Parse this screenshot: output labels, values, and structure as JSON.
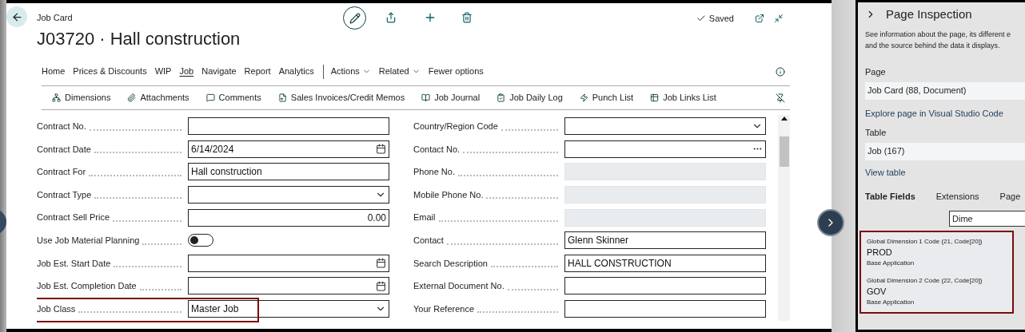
{
  "header": {
    "breadcrumb": "Job Card",
    "title": "J03720 · Hall construction",
    "status": "Saved"
  },
  "menu": [
    {
      "label": "Home",
      "selected": false,
      "dropdown": false
    },
    {
      "label": "Prices & Discounts",
      "selected": false,
      "dropdown": false
    },
    {
      "label": "WIP",
      "selected": false,
      "dropdown": false
    },
    {
      "label": "Job",
      "selected": true,
      "dropdown": false
    },
    {
      "label": "Navigate",
      "selected": false,
      "dropdown": false
    },
    {
      "label": "Report",
      "selected": false,
      "dropdown": false
    },
    {
      "label": "Analytics",
      "selected": false,
      "dropdown": false
    },
    {
      "label": "Actions",
      "selected": false,
      "dropdown": true
    },
    {
      "label": "Related",
      "selected": false,
      "dropdown": true
    },
    {
      "label": "Fewer options",
      "selected": false,
      "dropdown": false
    }
  ],
  "actions": [
    {
      "label": "Dimensions"
    },
    {
      "label": "Attachments"
    },
    {
      "label": "Comments"
    },
    {
      "label": "Sales Invoices/Credit Memos"
    },
    {
      "label": "Job Journal"
    },
    {
      "label": "Job Daily Log"
    },
    {
      "label": "Punch List"
    },
    {
      "label": "Job Links List"
    }
  ],
  "left_fields": [
    {
      "label": "Contract No.",
      "kind": "text"
    },
    {
      "label": "Contract Date",
      "kind": "date",
      "value": "6/14/2024"
    },
    {
      "label": "Contract For",
      "kind": "text",
      "value": "Hall construction"
    },
    {
      "label": "Contract Type",
      "kind": "dropdown"
    },
    {
      "label": "Contract Sell Price",
      "kind": "number",
      "value": "0.00"
    },
    {
      "label": "Use Job Material Planning",
      "kind": "toggle",
      "on": false
    },
    {
      "label": "Job Est. Start Date",
      "kind": "date"
    },
    {
      "label": "Job Est. Completion Date",
      "kind": "date"
    },
    {
      "label": "Job Class",
      "kind": "dropdown",
      "value": "Master Job",
      "highlighted": true
    }
  ],
  "right_fields": [
    {
      "label": "Country/Region Code",
      "kind": "dropdown"
    },
    {
      "label": "Contact No.",
      "kind": "lookup"
    },
    {
      "label": "Phone No.",
      "kind": "disabled"
    },
    {
      "label": "Mobile Phone No.",
      "kind": "disabled"
    },
    {
      "label": "Email",
      "kind": "disabled"
    },
    {
      "label": "Contact",
      "kind": "text",
      "value": "Glenn Skinner"
    },
    {
      "label": "Search Description",
      "kind": "text",
      "value": "HALL CONSTRUCTION"
    },
    {
      "label": "External Document No.",
      "kind": "text"
    },
    {
      "label": "Your Reference",
      "kind": "text"
    }
  ],
  "inspection": {
    "title": "Page Inspection",
    "description": [
      "See information about the page, its different e",
      "and the source behind the data it displays."
    ],
    "page_label": "Page",
    "page_value": "Job Card (88, Document)",
    "page_link": "Explore page in Visual Studio Code",
    "table_label": "Table",
    "table_value": "Job (167)",
    "table_link": "View table",
    "tabs": [
      {
        "label": "Table Fields",
        "selected": true
      },
      {
        "label": "Extensions",
        "selected": false
      },
      {
        "label": "Page",
        "selected": false
      }
    ],
    "filter": "Dime",
    "results": [
      {
        "caption": "Global Dimension 1 Code (21, Code[20])",
        "value": "PROD",
        "source": "Base Application"
      },
      {
        "caption": "Global Dimension 2 Code (22, Code[20])",
        "value": "GOV",
        "source": "Base Application"
      }
    ]
  }
}
